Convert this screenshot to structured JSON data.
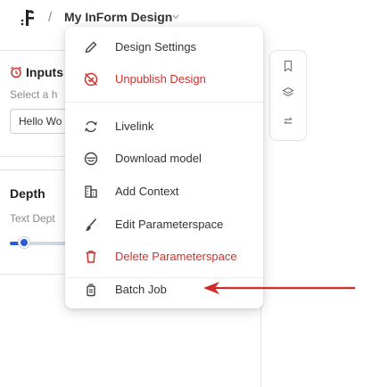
{
  "header": {
    "separator": "/",
    "design_title": "My InForm Design"
  },
  "inputs_panel": {
    "title": "Inputs",
    "subtitle": "Select a h",
    "field_value": "Hello Wo"
  },
  "depth_panel": {
    "title": "Depth",
    "subtitle": "Text Dept",
    "slider_level_fraction": 0.15
  },
  "menu": {
    "items": [
      {
        "label": "Design Settings",
        "icon": "pencil-icon",
        "danger": false
      },
      {
        "label": "Unpublish Design",
        "icon": "unpublish-icon",
        "danger": true
      },
      {
        "label": "Livelink",
        "icon": "sync-icon",
        "danger": false
      },
      {
        "label": "Download model",
        "icon": "download-model-icon",
        "danger": false
      },
      {
        "label": "Add Context",
        "icon": "buildings-icon",
        "danger": false
      },
      {
        "label": "Edit Parameterspace",
        "icon": "brush-icon",
        "danger": false
      },
      {
        "label": "Delete Parameterspace",
        "icon": "trash-icon",
        "danger": true
      },
      {
        "label": "Batch Job",
        "icon": "batch-job-icon",
        "danger": false
      }
    ]
  },
  "side_toolbar": {
    "icons": [
      "bookmark-icon",
      "layers-icon",
      "swap-icon"
    ]
  },
  "colors": {
    "danger": "#d0312d",
    "accent": "#2b5bd7",
    "annotation_arrow": "#d32a2a"
  }
}
